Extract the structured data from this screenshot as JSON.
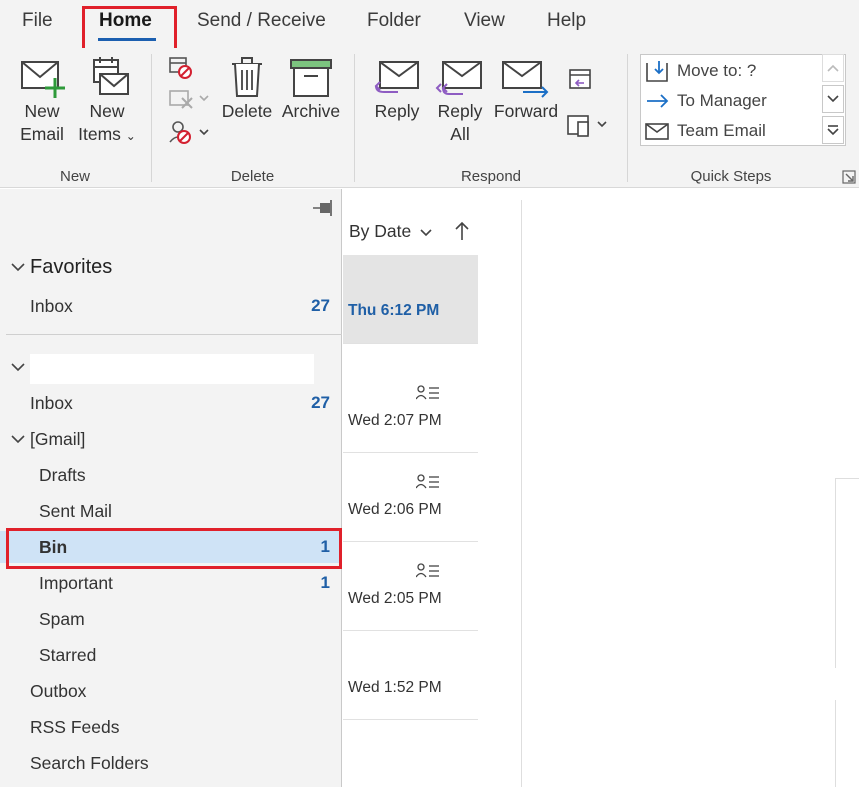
{
  "menu": {
    "tabs": [
      {
        "label": "File"
      },
      {
        "label": "Home"
      },
      {
        "label": "Send / Receive"
      },
      {
        "label": "Folder"
      },
      {
        "label": "View"
      },
      {
        "label": "Help"
      }
    ],
    "active_tab": "Home"
  },
  "ribbon": {
    "groups": {
      "new": "New",
      "delete": "Delete",
      "respond": "Respond",
      "quick_steps": "Quick Steps"
    },
    "buttons": {
      "new_email": [
        "New",
        "Email"
      ],
      "new_items": [
        "New",
        "Items"
      ],
      "delete": "Delete",
      "archive": "Archive",
      "reply": "Reply",
      "reply_all": [
        "Reply",
        "All"
      ],
      "forward": "Forward"
    },
    "quick_steps": [
      {
        "label": "Move to: ?",
        "icon": "move-to-folder-icon"
      },
      {
        "label": "To Manager",
        "icon": "arrow-right-icon"
      },
      {
        "label": "Team Email",
        "icon": "envelope-icon"
      }
    ]
  },
  "folders": {
    "favorites_header": "Favorites",
    "favorites": [
      {
        "label": "Inbox",
        "count": "27"
      }
    ],
    "account_items": [
      {
        "label": "Inbox",
        "count": "27",
        "indent": 1
      },
      {
        "label": "[Gmail]",
        "count": "",
        "indent": 0,
        "expander": true
      },
      {
        "label": "Drafts",
        "count": "",
        "indent": 2
      },
      {
        "label": "Sent Mail",
        "count": "",
        "indent": 2
      },
      {
        "label": "Bin",
        "count": "1",
        "indent": 2,
        "selected": true
      },
      {
        "label": "Important",
        "count": "1",
        "indent": 2
      },
      {
        "label": "Spam",
        "count": "",
        "indent": 2
      },
      {
        "label": "Starred",
        "count": "",
        "indent": 2
      },
      {
        "label": "Outbox",
        "count": "",
        "indent": 1
      },
      {
        "label": "RSS Feeds",
        "count": "",
        "indent": 1
      },
      {
        "label": "Search Folders",
        "count": "",
        "indent": 1
      }
    ]
  },
  "message_list": {
    "sort_label": "By Date",
    "messages": [
      {
        "date": "Thu 6:12 PM",
        "group_icon": false
      },
      {
        "date": "Wed 2:07 PM",
        "group_icon": true
      },
      {
        "date": "Wed 2:06 PM",
        "group_icon": true
      },
      {
        "date": "Wed 2:05 PM",
        "group_icon": true
      },
      {
        "date": "Wed 1:52 PM",
        "group_icon": false
      }
    ]
  },
  "colors": {
    "accent": "#1b5fb0",
    "highlight": "#e0202a",
    "count": "#1f5fa6",
    "selected_bg": "#cfe3f6"
  }
}
